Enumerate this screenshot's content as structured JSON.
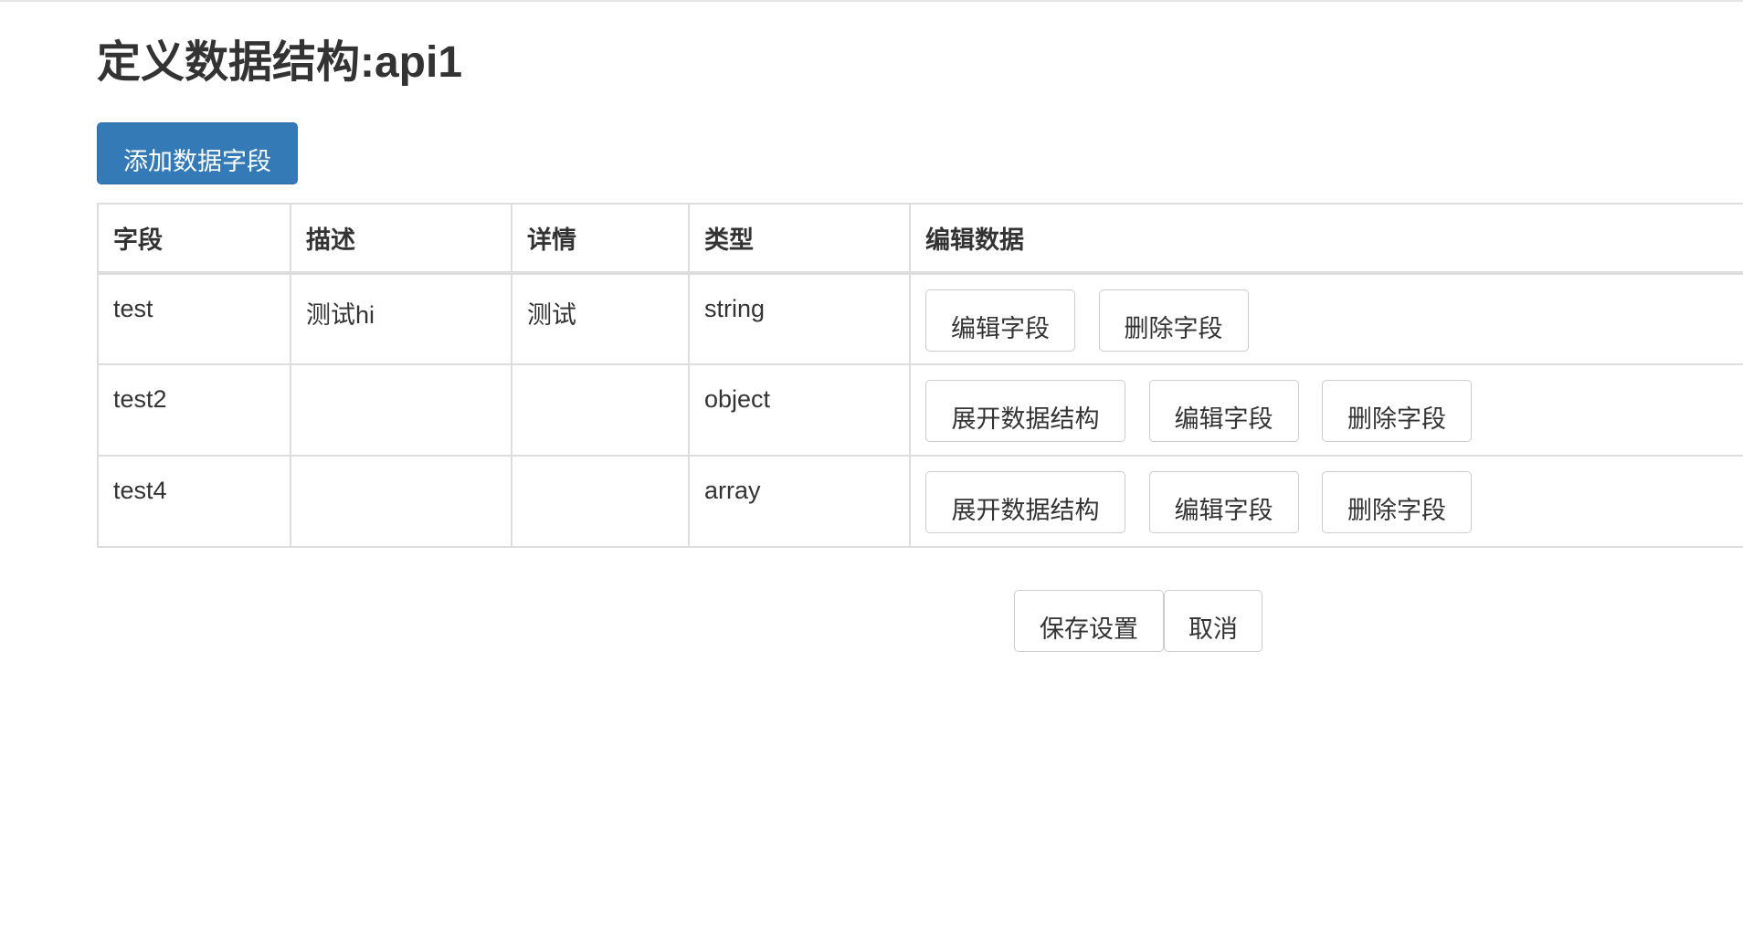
{
  "page": {
    "title": "定义数据结构:api1"
  },
  "toolbar": {
    "add_field_label": "添加数据字段"
  },
  "table": {
    "headers": [
      "字段",
      "描述",
      "详情",
      "类型",
      "编辑数据"
    ],
    "rows": [
      {
        "field": "test",
        "description": "测试hi",
        "detail": "测试",
        "type": "string",
        "actions": [
          "编辑字段",
          "删除字段"
        ]
      },
      {
        "field": "test2",
        "description": "",
        "detail": "",
        "type": "object",
        "actions": [
          "展开数据结构",
          "编辑字段",
          "删除字段"
        ]
      },
      {
        "field": "test4",
        "description": "",
        "detail": "",
        "type": "array",
        "actions": [
          "展开数据结构",
          "编辑字段",
          "删除字段"
        ]
      }
    ]
  },
  "footer": {
    "save_label": "保存设置",
    "cancel_label": "取消"
  },
  "colors": {
    "primary": "#337ab7",
    "border": "#dddddd",
    "text": "#333333"
  }
}
